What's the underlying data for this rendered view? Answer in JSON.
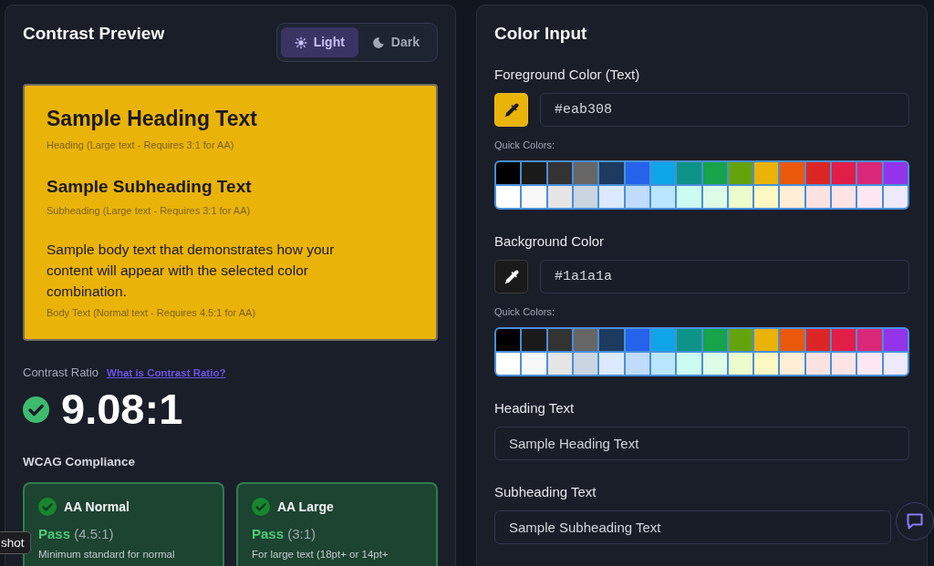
{
  "preview": {
    "title": "Contrast Preview",
    "theme_options": [
      {
        "label": "Light",
        "selected": true
      },
      {
        "label": "Dark",
        "selected": false
      }
    ],
    "sample": {
      "heading": "Sample Heading Text",
      "heading_note": "Heading (Large text - Requires 3:1 for AA)",
      "subheading": "Sample Subheading Text",
      "subheading_note": "Subheading (Large text - Requires 3:1 for AA)",
      "body": "Sample body text that demonstrates how your content will appear with the selected color combination.",
      "body_note": "Body Text (Normal text - Requires 4.5:1 for AA)"
    }
  },
  "contrast": {
    "label": "Contrast Ratio",
    "link": "What is Contrast Ratio?",
    "ratio": "9.08:1",
    "passed": true
  },
  "compliance": {
    "title": "WCAG Compliance",
    "items": [
      {
        "name": "AA Normal",
        "passed": true,
        "result": "Pass",
        "requirement": "(4.5:1)",
        "description": "Minimum standard for normal"
      },
      {
        "name": "AA Large",
        "passed": true,
        "result": "Pass",
        "requirement": "(3:1)",
        "description": "For large text (18pt+ or 14pt+"
      }
    ]
  },
  "color_input": {
    "title": "Color Input",
    "color_fields": [
      {
        "label": "Foreground Color (Text)",
        "color": "#eab308",
        "value": "#eab308",
        "quick_colors_label": "Quick Colors:",
        "quick_colors": [
          {
            "color": "#000000"
          },
          {
            "color": "#1a1a1a"
          },
          {
            "color": "#333333"
          },
          {
            "color": "#666666"
          },
          {
            "color": "#1e3a5f"
          },
          {
            "color": "#2563eb"
          },
          {
            "color": "#0ea5e9"
          },
          {
            "color": "#0d9488"
          },
          {
            "color": "#16a34a"
          },
          {
            "color": "#65a30d"
          },
          {
            "color": "#eab308"
          },
          {
            "color": "#ea580c"
          },
          {
            "color": "#dc2626"
          },
          {
            "color": "#e11d48"
          },
          {
            "color": "#db2777"
          },
          {
            "color": "#9333ea"
          },
          {
            "color": "#ffffff"
          },
          {
            "color": "#f8f8f8"
          },
          {
            "color": "#e5e5e5"
          },
          {
            "color": "#cbd5e1"
          },
          {
            "color": "#dbeafe"
          },
          {
            "color": "#bfdbfe"
          },
          {
            "color": "#bae6fd"
          },
          {
            "color": "#ccfbf1"
          },
          {
            "color": "#dcfce7"
          },
          {
            "color": "#ecfccb"
          },
          {
            "color": "#fef9c3"
          },
          {
            "color": "#ffedd5"
          },
          {
            "color": "#fee2e2"
          },
          {
            "color": "#ffe4e6"
          },
          {
            "color": "#fce7f3"
          },
          {
            "color": "#ede9fe"
          }
        ]
      },
      {
        "label": "Background Color",
        "color": "#1a1a1a",
        "value": "#1a1a1a",
        "quick_colors_label": "Quick Colors:",
        "quick_colors": [
          {
            "color": "#000000"
          },
          {
            "color": "#1a1a1a"
          },
          {
            "color": "#333333"
          },
          {
            "color": "#666666"
          },
          {
            "color": "#1e3a5f"
          },
          {
            "color": "#2563eb"
          },
          {
            "color": "#0ea5e9"
          },
          {
            "color": "#0d9488"
          },
          {
            "color": "#16a34a"
          },
          {
            "color": "#65a30d"
          },
          {
            "color": "#eab308"
          },
          {
            "color": "#ea580c"
          },
          {
            "color": "#dc2626"
          },
          {
            "color": "#e11d48"
          },
          {
            "color": "#db2777"
          },
          {
            "color": "#9333ea"
          },
          {
            "color": "#ffffff"
          },
          {
            "color": "#f8f8f8"
          },
          {
            "color": "#e5e5e5"
          },
          {
            "color": "#cbd5e1"
          },
          {
            "color": "#dbeafe"
          },
          {
            "color": "#bfdbfe"
          },
          {
            "color": "#bae6fd"
          },
          {
            "color": "#ccfbf1"
          },
          {
            "color": "#dcfce7"
          },
          {
            "color": "#ecfccb"
          },
          {
            "color": "#fef9c3"
          },
          {
            "color": "#ffedd5"
          },
          {
            "color": "#fee2e2"
          },
          {
            "color": "#ffe4e6"
          },
          {
            "color": "#fce7f3"
          },
          {
            "color": "#ede9fe"
          }
        ]
      }
    ],
    "text_fields": [
      {
        "label": "Heading Text",
        "value": "Sample Heading Text"
      },
      {
        "label": "Subheading Text",
        "value": "Sample Subheading Text"
      }
    ]
  },
  "tooltip": {
    "text": "shot"
  }
}
